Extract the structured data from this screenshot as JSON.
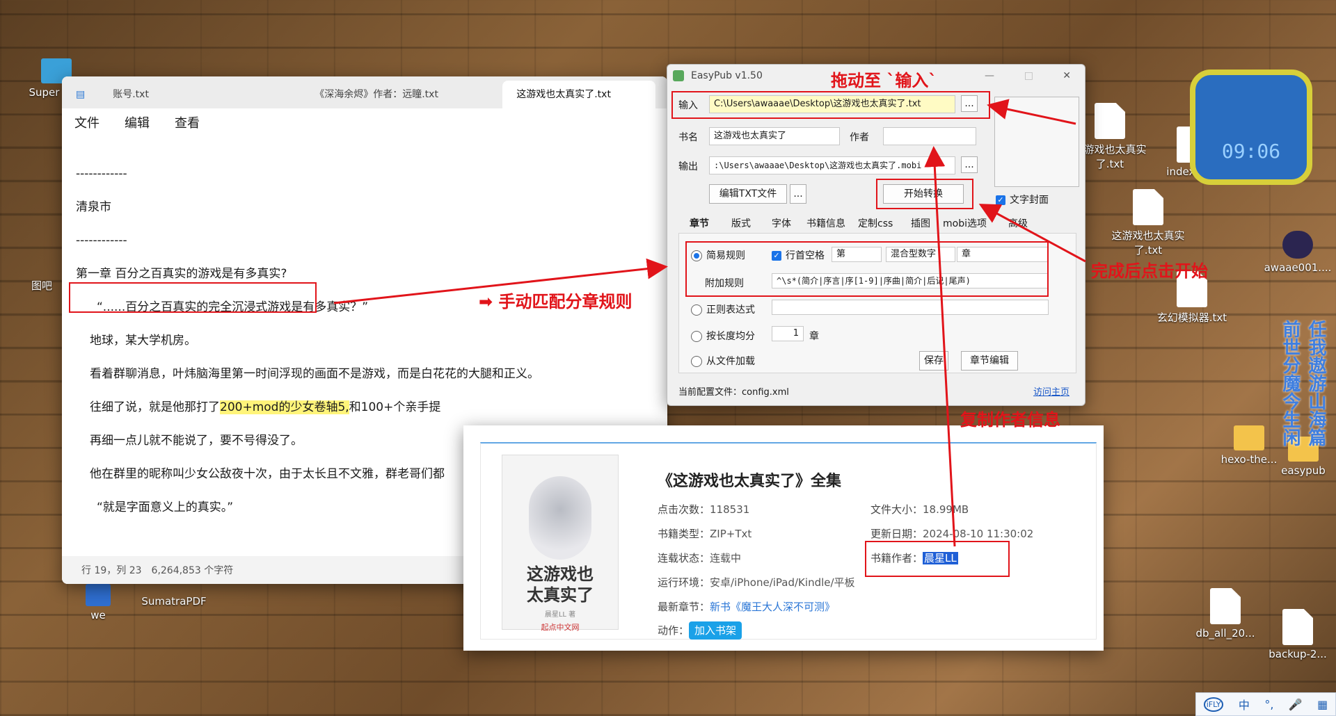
{
  "desktop": {
    "icons": [
      {
        "label": "Super Moc"
      },
      {
        "label": "图吧"
      },
      {
        "label": "we"
      },
      {
        "label": "SumatraPDF"
      },
      {
        "label": "这游戏也太真实了.txt"
      },
      {
        "label": "index.vue"
      },
      {
        "label": "这游戏也太真实了.txt"
      },
      {
        "label": "awaae001...."
      },
      {
        "label": "玄幻模拟器.txt"
      },
      {
        "label": "hexo-the..."
      },
      {
        "label": "easypub"
      },
      {
        "label": "db_all_20..."
      },
      {
        "label": "backup-2..."
      }
    ],
    "clock": "09:06",
    "poster_text": "任我遨游山海篇 前世分魔今生闲"
  },
  "notepad": {
    "tabs": [
      "账号.txt",
      "《深海余烬》作者：远瞳.txt",
      "这游戏也太真实了.txt"
    ],
    "menu": [
      "文件",
      "编辑",
      "查看"
    ],
    "lines": [
      "------------",
      "清泉市",
      "------------",
      "第一章 百分之百真实的游戏是有多真实?",
      "“......百分之百真实的完全沉浸式游戏是有多真实？”",
      "地球，某大学机房。",
      "看着群聊消息，叶炜脑海里第一时间浮现的画面不是游戏，而是白花花的大腿和正义。",
      "往细了说，就是他那打了",
      "200+mod的少女卷轴5,",
      "和100+个亲手提",
      "再细一点儿就不能说了，要不号得没了。",
      "他在群里的昵称叫少女公敌夜十次，由于太长且不文雅，群老哥们都",
      "“就是字面意义上的真实。”"
    ],
    "status": {
      "position": "行 19，列 23",
      "chars": "6,264,853 个字符"
    }
  },
  "easypub": {
    "title": "EasyPub v1.50",
    "input_label": "输入",
    "input_value": "C:\\Users\\awaaae\\Desktop\\这游戏也太真实了.txt",
    "name_label": "书名",
    "name_value": "这游戏也太真实了",
    "author_label": "作者",
    "author_value": "",
    "output_label": "输出",
    "output_value": ":\\Users\\awaaae\\Desktop\\这游戏也太真实了.mobi",
    "edit_txt": "编辑TXT文件",
    "start": "开始转换",
    "cover_text": "文字封面",
    "tabs": [
      "章节",
      "版式",
      "字体",
      "书籍信息",
      "定制css",
      "插图",
      "mobi选项",
      "高级"
    ],
    "simple_rule": "简易规则",
    "line_space": "行首空格",
    "combo1": "第",
    "combo2": "混合型数字",
    "combo3": "章",
    "extra_rule": "附加规则",
    "extra_value": "^\\s*(简介|序言|序[1-9]|序曲|简介|后记|尾声)",
    "regex": "正则表达式",
    "by_length": "按长度均分",
    "length_value": "1",
    "length_unit": "章",
    "from_file": "从文件加载",
    "save": "保存",
    "chapter_edit": "章节编辑",
    "config": "当前配置文件：config.xml",
    "homepage": "访问主页",
    "ellipsis": "..."
  },
  "book": {
    "title": "《这游戏也太真实了》全集",
    "cover_title": "这游戏也太真实了",
    "cover_author": "晨星LL 著",
    "cover_brand": "起点中文网",
    "clicks_label": "点击次数：",
    "clicks": "118531",
    "type_label": "书籍类型：",
    "type": "ZIP+Txt",
    "status_label": "连载状态：",
    "status": "连载中",
    "env_label": "运行环境：",
    "env": "安卓/iPhone/iPad/Kindle/平板",
    "latest_label": "最新章节：",
    "latest": "新书《魔王大人深不可测》",
    "action_label": "动作：",
    "action": "加入书架",
    "size_label": "文件大小：",
    "size": "18.99MB",
    "date_label": "更新日期：",
    "date": "2024-08-10 11:30:02",
    "author_label": "书籍作者：",
    "author": "晨星LL"
  },
  "annotations": {
    "drag": "拖动至 `输入`",
    "match": "➡ 手动匹配分章规则",
    "start_after": "完成后点击开始",
    "copy_author": "复制作者信息"
  },
  "ime": [
    "iFLY",
    "中",
    "°,",
    "🎤",
    "▦"
  ]
}
